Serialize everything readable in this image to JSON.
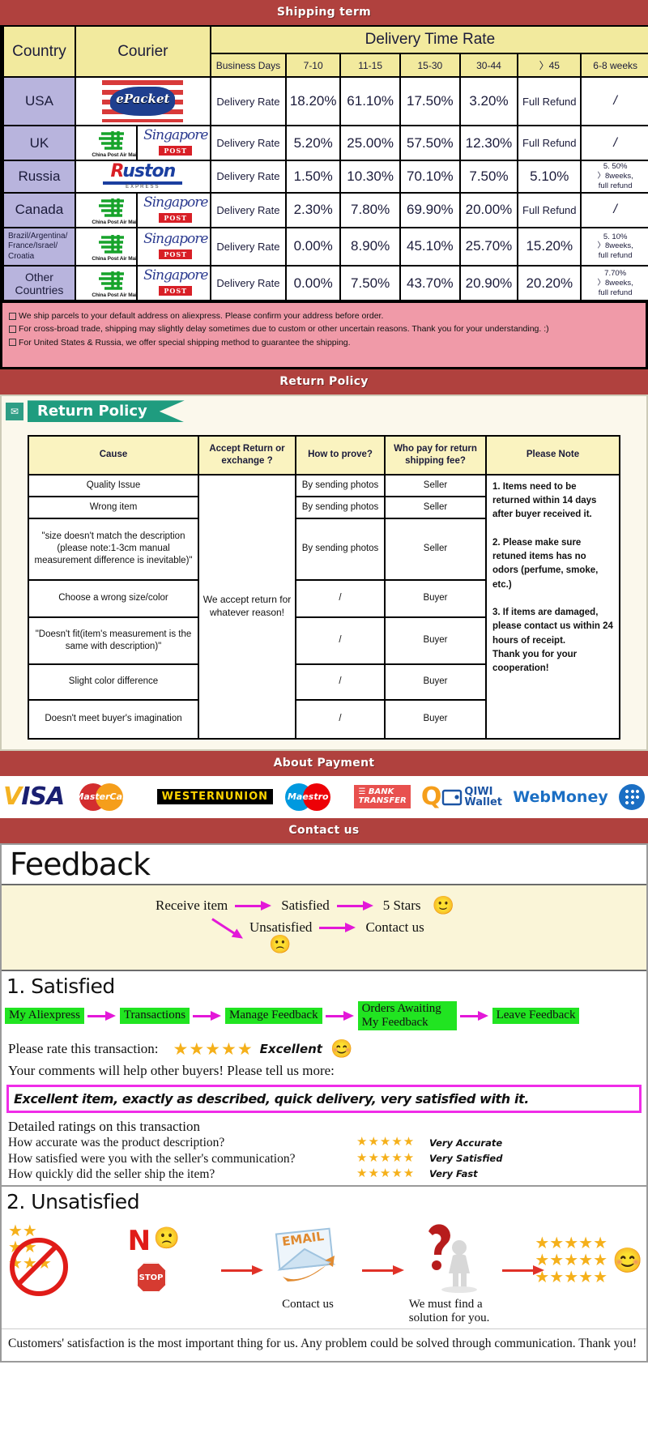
{
  "banners": {
    "shipping": "Shipping term",
    "return": "Return Policy",
    "payment": "About Payment",
    "contact": "Contact us"
  },
  "shipping": {
    "headers": {
      "country": "Country",
      "courier": "Courier",
      "delivery_time_rate": "Delivery Time Rate",
      "business_days": "Business Days",
      "ranges": [
        "7-10",
        "11-15",
        "15-30",
        "30-44",
        "〉45",
        "6-8 weeks"
      ]
    },
    "rate_label": "Delivery Rate",
    "rows": [
      {
        "country": "USA",
        "couriers": [
          "ePacket"
        ],
        "values": [
          "18.20%",
          "61.10%",
          "17.50%",
          "3.20%",
          "Full Refund",
          "/"
        ]
      },
      {
        "country": "UK",
        "couriers": [
          "China Post Air Mail",
          "Singapore POST"
        ],
        "values": [
          "5.20%",
          "25.00%",
          "57.50%",
          "12.30%",
          "Full Refund",
          "/"
        ]
      },
      {
        "country": "Russia",
        "couriers": [
          "Ruston EXPRESS"
        ],
        "values": [
          "1.50%",
          "10.30%",
          "70.10%",
          "7.50%",
          "5.10%",
          "5. 50%\n〉8weeks,\nfull refund"
        ]
      },
      {
        "country": "Canada",
        "couriers": [
          "China Post Air Mail",
          "Singapore POST"
        ],
        "values": [
          "2.30%",
          "7.80%",
          "69.90%",
          "20.00%",
          "Full Refund",
          "/"
        ]
      },
      {
        "country": "Brazil/Argentina/\nFrance/Israel/\nCroatia",
        "couriers": [
          "China Post Air Mail",
          "Singapore POST"
        ],
        "values": [
          "0.00%",
          "8.90%",
          "45.10%",
          "25.70%",
          "15.20%",
          "5. 10%\n〉8weeks,\nfull refund"
        ]
      },
      {
        "country": "Other Countries",
        "couriers": [
          "China Post Air Mail",
          "Singapore POST"
        ],
        "values": [
          "0.00%",
          "7.50%",
          "43.70%",
          "20.90%",
          "20.20%",
          "7.70%\n〉8weeks,\nfull refund"
        ]
      }
    ],
    "notes": [
      "We ship parcels to your default address on aliexpress. Please confirm your address before order.",
      "For cross-broad trade, shipping may slightly delay sometimes due to custom or other uncertain reasons. Thank you for your understanding. :)",
      "For United States & Russia, we offer special shipping method to guarantee the shipping."
    ]
  },
  "return_policy": {
    "ribbon_label": "Return Policy",
    "ribbon_icon": "mail-icon",
    "headers": [
      "Cause",
      "Accept Return or exchange ?",
      "How to prove?",
      "Who pay for return shipping fee?",
      "Please Note"
    ],
    "accept_text": "We accept return for whatever reason!",
    "rows": [
      {
        "cause": "Quality Issue",
        "prove": "By sending photos",
        "who_pays": "Seller"
      },
      {
        "cause": "Wrong item",
        "prove": "By sending photos",
        "who_pays": "Seller"
      },
      {
        "cause": "\"size doesn't match the description (please note:1-3cm manual measurement difference is inevitable)\"",
        "prove": "By sending photos",
        "who_pays": "Seller"
      },
      {
        "cause": "Choose a wrong size/color",
        "prove": "/",
        "who_pays": "Buyer"
      },
      {
        "cause": "\"Doesn't fit(item's measurement is the same with description)\"",
        "prove": "/",
        "who_pays": "Buyer"
      },
      {
        "cause": "Slight color difference",
        "prove": "/",
        "who_pays": "Buyer"
      },
      {
        "cause": "Doesn't meet buyer's imagination",
        "prove": "/",
        "who_pays": "Buyer"
      }
    ],
    "note": "1. Items need to be returned within 14 days after buyer received it.\n\n2. Please make sure retuned items has no odors (perfume, smoke, etc.)\n\n3. If items are damaged, please contact us within 24 hours of receipt.\nThank you for your cooperation!"
  },
  "payment": {
    "methods": [
      "VISA",
      "MasterCard",
      "WESTERN UNION",
      "Maestro",
      "BANK TRANSFER",
      "QIWI Wallet",
      "WebMoney",
      "webmoney-badge"
    ]
  },
  "feedback": {
    "title": "Feedback",
    "flow": {
      "receive": "Receive item",
      "satisfied": "Satisfied",
      "five_stars": "5 Stars",
      "unsatisfied": "Unsatisfied",
      "contact_us": "Contact us",
      "happy_emoji": "🙂",
      "sad_emoji": "🙁"
    },
    "satisfied": {
      "heading": "1. Satisfied",
      "steps": [
        "My Aliexpress",
        "Transactions",
        "Manage Feedback",
        "Orders Awaiting My Feedback",
        "Leave Feedback"
      ],
      "rate_label": "Please rate this transaction:",
      "stars": "★★★★★",
      "excellent": "Excellent",
      "comment_prompt": "Your comments will help other buyers! Please tell us more:",
      "quote": "Excellent item, exactly as described, quick delivery, very satisfied with it.",
      "detailed_heading": "Detailed ratings on this transaction",
      "ratings": [
        {
          "question": "How accurate was the product description?",
          "stars": "★★★★★",
          "label": "Very Accurate"
        },
        {
          "question": "How satisfied were you with the seller's communication?",
          "stars": "★★★★★",
          "label": "Very Satisfied"
        },
        {
          "question": "How quickly did the seller ship the item?",
          "stars": "★★★★★",
          "label": "Very Fast"
        }
      ]
    },
    "unsatisfied": {
      "heading": "2. Unsatisfied",
      "no_text": "N",
      "stop_text": "STOP",
      "email_text": "EMAIL",
      "contact_caption": "Contact us",
      "solution_caption": "We must find a solution for you.",
      "final_stars": "★★★★★",
      "closing": "Customers' satisfaction is the most important thing for us. Any problem could be solved through communication. Thank you!"
    }
  }
}
